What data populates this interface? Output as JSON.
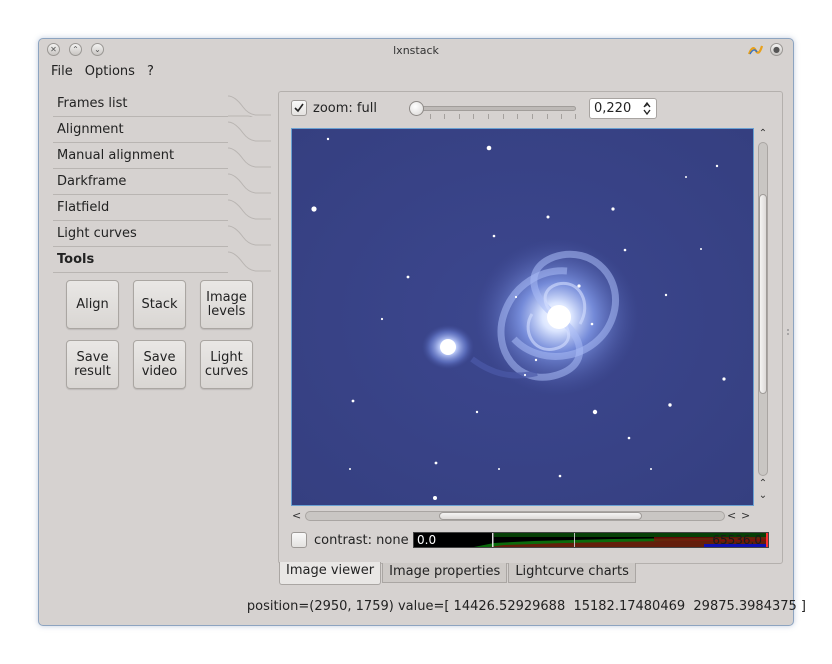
{
  "window": {
    "title": "lxnstack",
    "close_glyph": "✕",
    "minimize_glyph": "⌃",
    "maximize_glyph": "⌄"
  },
  "menu": [
    "File",
    "Options",
    "?"
  ],
  "toolbox": {
    "tabs": [
      "Frames list",
      "Alignment",
      "Manual alignment",
      "Darkframe",
      "Flatfield",
      "Light curves",
      "Tools"
    ],
    "active_tab": "Tools",
    "tools": [
      "Align",
      "Stack",
      "Image\nlevels",
      "Save\nresult",
      "Save\nvideo",
      "Light\ncurves"
    ]
  },
  "viewer": {
    "zoom_checked": true,
    "zoom_label": "zoom: full",
    "zoom_slider_fraction": 0.0,
    "zoom_value": "0,220",
    "contrast_checked": false,
    "contrast_label": "contrast: none",
    "contrast_min": "0.0",
    "contrast_max": "65536.0"
  },
  "tabs": [
    "Image viewer",
    "Image properties",
    "Lightcurve charts"
  ],
  "active_tab": "Image viewer",
  "status": "position=(2950, 1759) value=[ 14426.52929688  15182.17480469  29875.3984375 ]",
  "colors": {
    "window_bg": "#d6d2d0",
    "sky": "#3a4488",
    "galaxy_core": "#ffffff",
    "galaxy_arm": "#9fb4f4"
  }
}
